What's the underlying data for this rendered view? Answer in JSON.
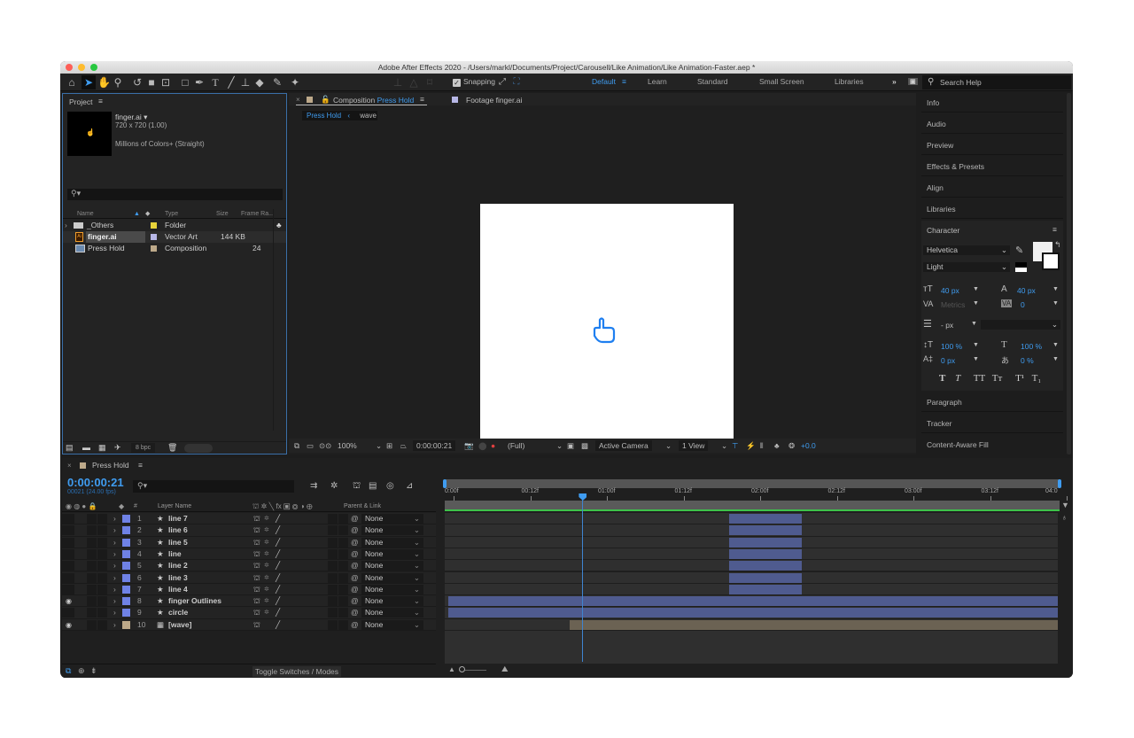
{
  "window": {
    "title": "Adobe After Effects 2020 - /Users/markl/Documents/Project/Carousell/Like Animation/Like Animation-Faster.aep *"
  },
  "toolbar": {
    "tools": [
      "home",
      "selection",
      "hand",
      "zoom",
      "rotate",
      "camera",
      "pan-behind",
      "rectangle",
      "pen",
      "type",
      "brush",
      "clone-stamp",
      "eraser",
      "roto-brush",
      "puppet-pin"
    ],
    "snapping_label": "Snapping",
    "snapping_checked": true,
    "workspaces": [
      "Default",
      "Learn",
      "Standard",
      "Small Screen",
      "Libraries"
    ],
    "active_workspace": "Default",
    "overflow": "»",
    "search_placeholder": "Search Help"
  },
  "project": {
    "title": "Project",
    "preview": {
      "name": "finger.ai ▾",
      "dimensions": "720 x 720 (1.00)",
      "colors": "Millions of Colors+ (Straight)"
    },
    "search_placeholder": "",
    "columns": [
      "Name",
      "Type",
      "Size",
      "Frame Ra..."
    ],
    "items": [
      {
        "name": "_Others",
        "type": "Folder",
        "size": "",
        "fps": "",
        "label_color": "#e8d33a",
        "icon": "folder-icon",
        "expandable": true
      },
      {
        "name": "finger.ai",
        "type": "Vector Art",
        "size": "144 KB",
        "fps": "",
        "label_color": "#b7b7e6",
        "icon": "illustrator-file-icon",
        "selected": true
      },
      {
        "name": "Press Hold",
        "type": "Composition",
        "size": "",
        "fps": "24",
        "label_color": "#bda98a",
        "icon": "composition-icon"
      }
    ],
    "bpc": "8 bpc"
  },
  "viewer": {
    "tabs": [
      {
        "label_prefix": "Composition",
        "label": "Press Hold",
        "active": true,
        "color": "#bda98a"
      },
      {
        "label_prefix": "Footage",
        "label": "finger.ai",
        "active": false,
        "color": "#b7b7e6"
      }
    ],
    "breadcrumb": [
      "Press Hold",
      "wave"
    ],
    "zoom": "100%",
    "timecode": "0:00:00:21",
    "resolution": "(Full)",
    "camera": "Active Camera",
    "views": "1 View",
    "exposure": "+0.0"
  },
  "right_panel": {
    "items": [
      "Info",
      "Audio",
      "Preview",
      "Effects & Presets",
      "Align",
      "Libraries"
    ],
    "character": {
      "title": "Character",
      "font": "Helvetica",
      "style": "Light",
      "font_size": "40 px",
      "leading": "40 px",
      "kerning": "Metrics",
      "tracking": "0",
      "stroke_width": "- px",
      "vertical_scale": "100 %",
      "horizontal_scale": "100 %",
      "baseline_shift": "0 px",
      "tsume": "0 %",
      "format_buttons": [
        "T",
        "T",
        "TT",
        "Tт",
        "T¹",
        "T₁"
      ]
    },
    "bottom_items": [
      "Paragraph",
      "Tracker",
      "Content-Aware Fill"
    ]
  },
  "timeline": {
    "tab": "Press Hold",
    "timecode": "0:00:00:21",
    "frame_info": "00021 (24.00 fps)",
    "columns": {
      "num": "#",
      "name": "Layer Name",
      "parent": "Parent & Link"
    },
    "ruler": [
      "0:00f",
      "00:12f",
      "01:00f",
      "01:12f",
      "02:00f",
      "02:12f",
      "03:00f",
      "03:12f",
      "04:0"
    ],
    "toggle_label": "Toggle Switches / Modes",
    "duration_seconds": 4,
    "current_time_seconds": 0.875,
    "layers": [
      {
        "num": "1",
        "name": "line 7",
        "color": "#6f82e6",
        "icon": "star",
        "parent": "None",
        "visible": false,
        "in": 1.83,
        "out": 2.33,
        "bar": "#4f5b8f"
      },
      {
        "num": "2",
        "name": "line 6",
        "color": "#6f82e6",
        "icon": "star",
        "parent": "None",
        "visible": false,
        "in": 1.83,
        "out": 2.33,
        "bar": "#4f5b8f"
      },
      {
        "num": "3",
        "name": "line 5",
        "color": "#6f82e6",
        "icon": "star",
        "parent": "None",
        "visible": false,
        "in": 1.83,
        "out": 2.33,
        "bar": "#4f5b8f"
      },
      {
        "num": "4",
        "name": "line",
        "color": "#6f82e6",
        "icon": "star",
        "parent": "None",
        "visible": false,
        "in": 1.83,
        "out": 2.33,
        "bar": "#4f5b8f"
      },
      {
        "num": "5",
        "name": "line 2",
        "color": "#6f82e6",
        "icon": "star",
        "parent": "None",
        "visible": false,
        "in": 1.83,
        "out": 2.33,
        "bar": "#4f5b8f"
      },
      {
        "num": "6",
        "name": "line 3",
        "color": "#6f82e6",
        "icon": "star",
        "parent": "None",
        "visible": false,
        "in": 1.83,
        "out": 2.33,
        "bar": "#4f5b8f"
      },
      {
        "num": "7",
        "name": "line 4",
        "color": "#6f82e6",
        "icon": "star",
        "parent": "None",
        "visible": false,
        "in": 1.83,
        "out": 2.33,
        "bar": "#4f5b8f"
      },
      {
        "num": "8",
        "name": "finger Outlines",
        "color": "#6f82e6",
        "icon": "star",
        "parent": "None",
        "visible": true,
        "in": 0,
        "out": 4,
        "bar": "#4f5b8f"
      },
      {
        "num": "9",
        "name": "circle",
        "color": "#6f82e6",
        "icon": "star",
        "parent": "None",
        "visible": false,
        "in": 0,
        "out": 4,
        "bar": "#4f5b8f"
      },
      {
        "num": "10",
        "name": "[wave]",
        "color": "#bda98a",
        "icon": "comp",
        "parent": "None",
        "visible": true,
        "in": 0.79,
        "out": 4.05,
        "bar": "#6b6253"
      }
    ]
  }
}
